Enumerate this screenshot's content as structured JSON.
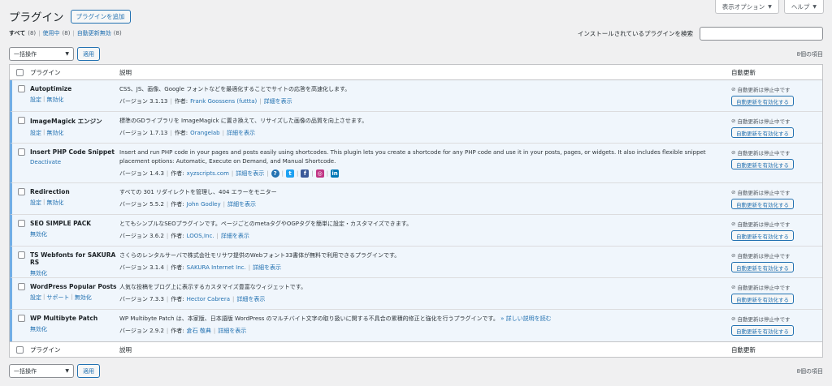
{
  "screen_options": {
    "display_options": "表示オプション",
    "help": "ヘルプ"
  },
  "header": {
    "title": "プラグイン",
    "add_new": "プラグインを追加"
  },
  "filters": [
    {
      "label": "すべて",
      "count": "(8)"
    },
    {
      "label": "使用中",
      "count": "(8)"
    },
    {
      "label": "自動更新無効",
      "count": "(8)"
    }
  ],
  "search": {
    "label": "インストールされているプラグインを検索",
    "placeholder": ""
  },
  "tablenav": {
    "bulk_action": "一括操作",
    "apply": "適用",
    "items": "8個の項目"
  },
  "columns": {
    "plugin": "プラグイン",
    "description": "説明",
    "auto_update": "自動更新"
  },
  "auto_update": {
    "status": "自動更新は停止中です",
    "enable": "自動更新を有効化する"
  },
  "plugins": [
    {
      "name": "Autoptimize",
      "actions": [
        "設定",
        "無効化"
      ],
      "description": "CSS、JS、画像、Google フォントなどを最適化することでサイトの応答を高速化します。",
      "version": "バージョン 3.1.13",
      "author_prefix": "作者:",
      "author": "Frank Goossens (futtta)",
      "details": "詳細を表示"
    },
    {
      "name": "ImageMagick エンジン",
      "actions": [
        "設定",
        "無効化"
      ],
      "description": "標準のGDライブラリを ImageMagick に置き換えて、リサイズした画像の品質を向上させます。",
      "version": "バージョン 1.7.13",
      "author_prefix": "作者:",
      "author": "Orangelab",
      "details": "詳細を表示"
    },
    {
      "name": "Insert PHP Code Snippet",
      "actions": [
        "Deactivate"
      ],
      "description": "Insert and run PHP code in your pages and posts easily using shortcodes. This plugin lets you create a shortcode for any PHP code and use it in your posts, pages, or widgets. It also includes flexible snippet placement options: Automatic, Execute on Demand, and Manual Shortcode.",
      "version": "バージョン 1.4.3",
      "author_prefix": "作者:",
      "author": "xyzscripts.com",
      "details": "詳細を表示",
      "social": [
        "?",
        "t",
        "f",
        "ig",
        "in"
      ]
    },
    {
      "name": "Redirection",
      "actions": [
        "設定",
        "無効化"
      ],
      "description": "すべての 301 リダイレクトを管理し、404 エラーをモニター",
      "version": "バージョン 5.5.2",
      "author_prefix": "作者:",
      "author": "John Godley",
      "details": "詳細を表示"
    },
    {
      "name": "SEO SIMPLE PACK",
      "actions": [
        "無効化"
      ],
      "description": "とてもシンプルなSEOプラグインです。ページごとのmetaタグやOGPタグを簡単に設定・カスタマイズできます。",
      "version": "バージョン 3.6.2",
      "author_prefix": "作者:",
      "author": "LOOS,Inc.",
      "details": "詳細を表示"
    },
    {
      "name": "TS Webfonts for SAKURA RS",
      "actions": [
        "無効化"
      ],
      "description": "さくらのレンタルサーバで株式会社モリサワ提供のWebフォント33書体が無料で利用できるプラグインです。",
      "version": "バージョン 3.1.4",
      "author_prefix": "作者:",
      "author": "SAKURA Internet Inc.",
      "details": "詳細を表示"
    },
    {
      "name": "WordPress Popular Posts",
      "actions": [
        "設定",
        "サポート",
        "無効化"
      ],
      "description": "人気な投稿をブログ上に表示するカスタマイズ豊富なウィジェットです。",
      "version": "バージョン 7.3.3",
      "author_prefix": "作者:",
      "author": "Hector Cabrera",
      "details": "詳細を表示"
    },
    {
      "name": "WP Multibyte Patch",
      "actions": [
        "無効化"
      ],
      "description": "WP Multibyte Patch は、本家版、日本語版 WordPress のマルチバイト文字の取り扱いに関する不具合の累積的修正と強化を行うプラグインです。",
      "more_link": "» 詳しい説明を読む",
      "version": "バージョン 2.9.2",
      "author_prefix": "作者:",
      "author": "倉石 敬典",
      "details": "詳細を表示"
    }
  ]
}
